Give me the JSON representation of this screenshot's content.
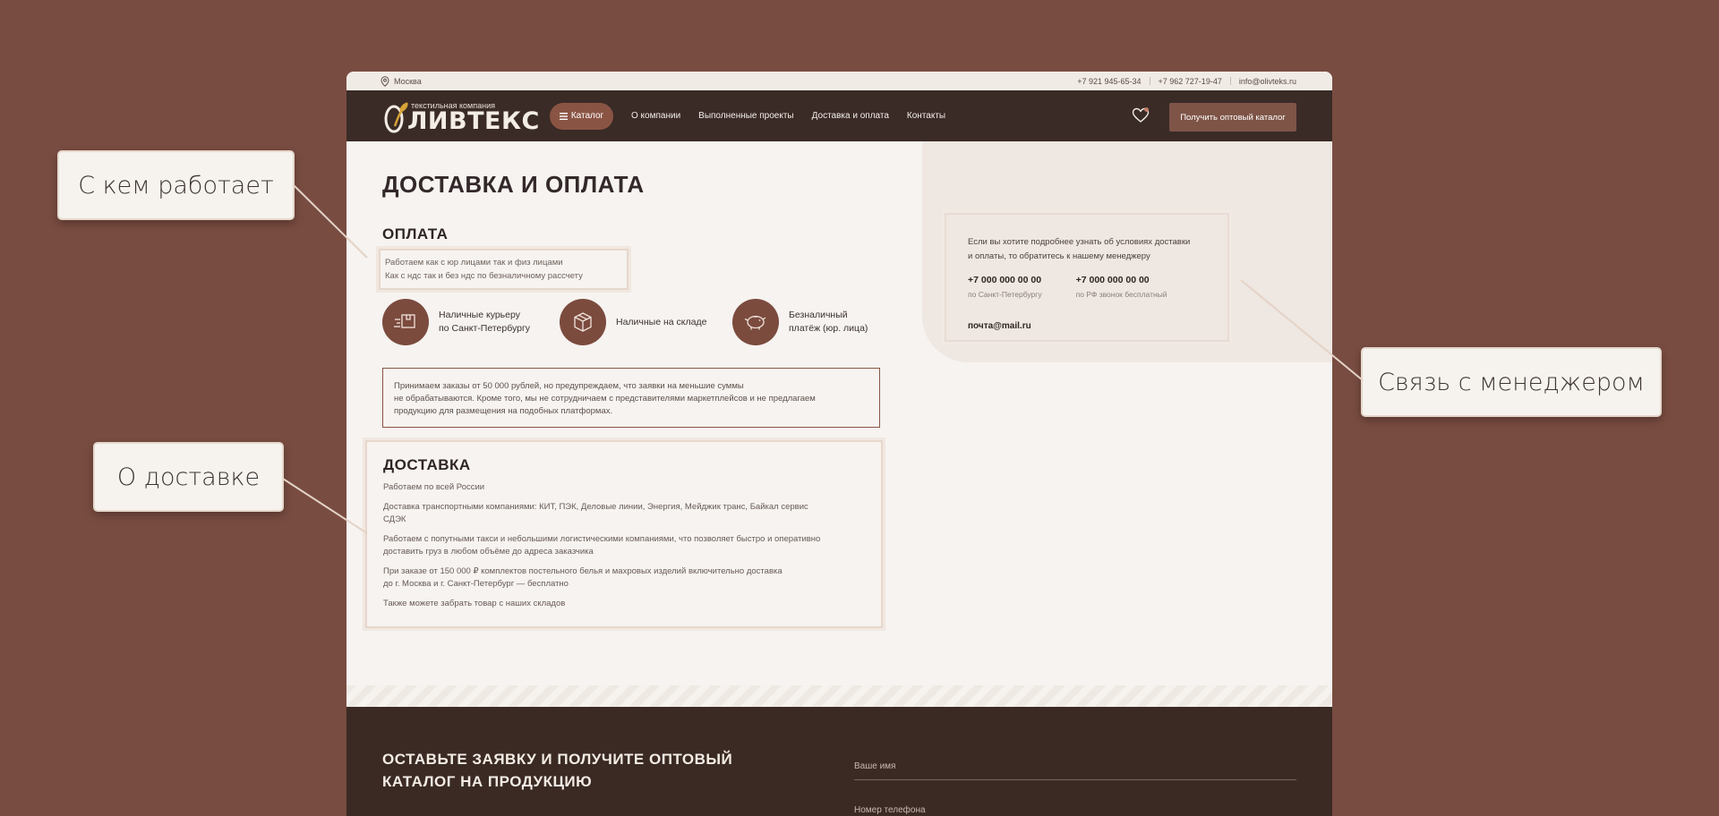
{
  "annotations": {
    "who": "С кем работает",
    "delivery": "О доставке",
    "manager": "Связь с менеджером"
  },
  "topbar": {
    "city": "Москва",
    "phone1": "+7 921 945-65-34",
    "phone2": "+7 962 727-19-47",
    "email": "info@olivteks.ru"
  },
  "header": {
    "logo_small": "текстильная компания",
    "logo_big": "ЛИВТЕКС",
    "catalog_label": "Каталог",
    "nav": [
      "О компании",
      "Выполненные проекты",
      "Доставка и оплата",
      "Контакты"
    ],
    "cta_label": "Получить оптовый каталог"
  },
  "page": {
    "title": "ДОСТАВКА И ОПЛАТА",
    "payment_title": "ОПЛАТА",
    "payment_lines": [
      "Работаем как с юр лицами так и физ лицами",
      "Как с ндс так и без ндс по безналичному рассчету"
    ],
    "payment_methods": [
      {
        "line1": "Наличные курьеру",
        "line2": "по Санкт-Петербургу"
      },
      {
        "line1": "Наличные на складе",
        "line2": ""
      },
      {
        "line1": "Безналичный",
        "line2": "платёж (юр. лица)"
      }
    ],
    "warning": [
      "Принимаем заказы от 50 000 рублей, но предупреждаем, что заявки на меньшие суммы",
      "не обрабатываются. Кроме того, мы не сотрудничаем с представителями маркетплейсов и не предлагаем",
      "продукцию для размещения на подобных платформах."
    ],
    "delivery_title": "ДОСТАВКА",
    "delivery_paragraphs": [
      [
        "Работаем по всей России"
      ],
      [
        "Доставка транспортными компаниями: КИТ, ПЭК, Деловые линии, Энергия, Мейджик транс, Байкал сервис",
        "СДЭК"
      ],
      [
        "Работаем с попутными такси и небольшими логистическими компаниями, что позволяет быстро и оперативно",
        "доставить груз в любом объёме до адреса заказчика"
      ],
      [
        "При заказе от 150 000 ₽ комплектов постельного белья и махровых изделий включительно доставка",
        "до г. Москва и г. Санкт-Петербург — бесплатно"
      ],
      [
        "Также можете забрать товар с наших складов"
      ]
    ]
  },
  "manager": {
    "text": [
      "Если вы хотите подробнее узнать об условиях доставки",
      "и оплаты, то обратитесь к нашему менеджеру"
    ],
    "phone1": "+7 000 000 00 00",
    "phone1_sub": "по Санкт-Петербургу",
    "phone2": "+7 000 000 00 00",
    "phone2_sub": "по РФ звонок бесплатный",
    "email": "почта@mail.ru"
  },
  "footer": {
    "title_line1": "ОСТАВЬТЕ ЗАЯВКУ И ПОЛУЧИТЕ ОПТОВЫЙ",
    "title_line2": "КАТАЛОГ НА ПРОДУКЦИЮ",
    "name_placeholder": "Ваше имя",
    "phone_placeholder": "Номер телефона"
  },
  "colors": {
    "background": "#794c41",
    "header": "#3a2b27",
    "accent": "#8a5444",
    "page": "#f6f3f0"
  }
}
